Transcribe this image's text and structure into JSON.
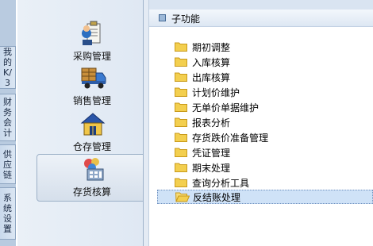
{
  "tabs": [
    {
      "label": "我的K/3"
    },
    {
      "label": "财务会计"
    },
    {
      "label": "供应链"
    },
    {
      "label": "系统设置"
    }
  ],
  "modules": [
    {
      "label": "采购管理",
      "icon": "purchase-clipboard-icon"
    },
    {
      "label": "销售管理",
      "icon": "delivery-truck-icon"
    },
    {
      "label": "仓存管理",
      "icon": "warehouse-house-icon"
    },
    {
      "label": "存货核算",
      "icon": "inventory-calculator-icon",
      "active": true
    }
  ],
  "subfunctions": {
    "title": "子功能",
    "items": [
      {
        "label": "期初调整"
      },
      {
        "label": "入库核算"
      },
      {
        "label": "出库核算"
      },
      {
        "label": "计划价维护"
      },
      {
        "label": "无单价单据维护"
      },
      {
        "label": "报表分析"
      },
      {
        "label": "存货跌价准备管理"
      },
      {
        "label": "凭证管理"
      },
      {
        "label": "期末处理"
      },
      {
        "label": "查询分析工具"
      },
      {
        "label": "反结账处理",
        "selected": true
      }
    ]
  },
  "colors": {
    "folder": "#f3cf4f",
    "folder_dark": "#c99a1b",
    "selection": "#cfe2f7"
  }
}
